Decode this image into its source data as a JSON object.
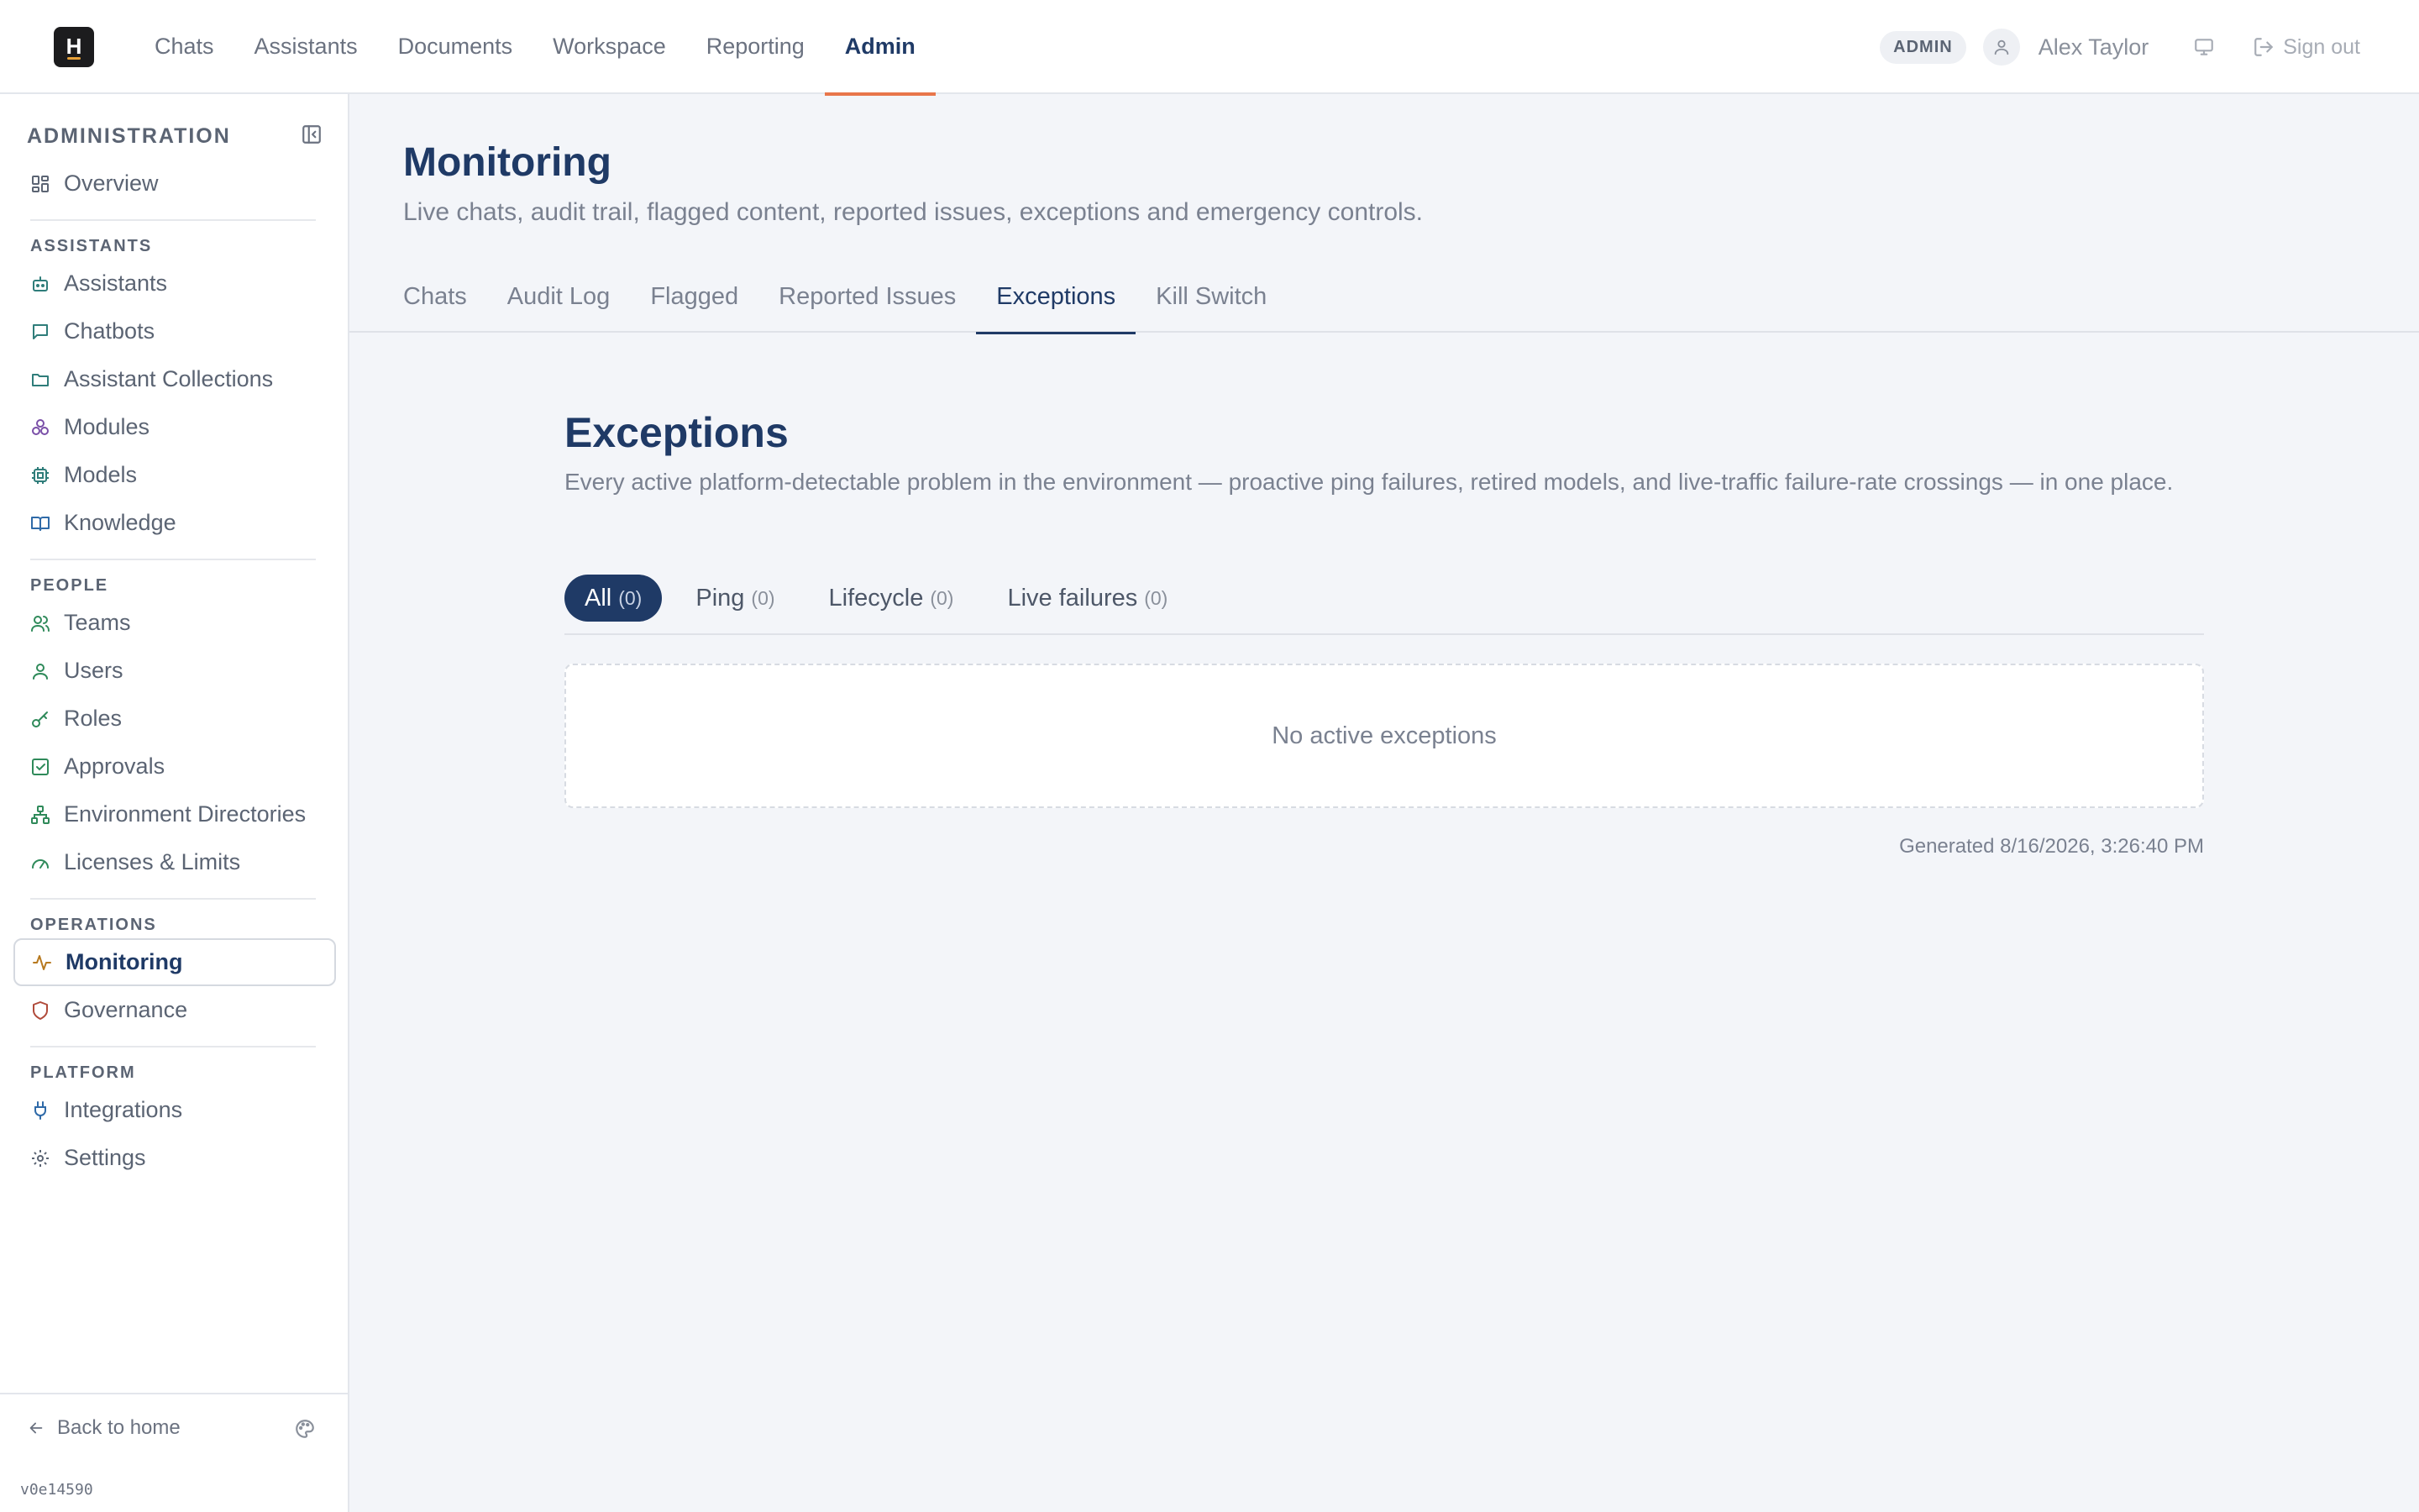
{
  "topnav": {
    "logo_letter": "H",
    "items": [
      {
        "label": "Chats"
      },
      {
        "label": "Assistants"
      },
      {
        "label": "Documents"
      },
      {
        "label": "Workspace"
      },
      {
        "label": "Reporting"
      },
      {
        "label": "Admin",
        "active": true
      }
    ],
    "role_badge": "ADMIN",
    "user_name": "Alex Taylor",
    "sign_out": "Sign out"
  },
  "sidebar": {
    "title": "ADMINISTRATION",
    "overview": "Overview",
    "groups": {
      "assistants": {
        "label": "ASSISTANTS",
        "items": [
          "Assistants",
          "Chatbots",
          "Assistant Collections",
          "Modules",
          "Models",
          "Knowledge"
        ]
      },
      "people": {
        "label": "PEOPLE",
        "items": [
          "Teams",
          "Users",
          "Roles",
          "Approvals",
          "Environment Directories",
          "Licenses & Limits"
        ]
      },
      "operations": {
        "label": "OPERATIONS",
        "items": [
          "Monitoring",
          "Governance"
        ]
      },
      "platform": {
        "label": "PLATFORM",
        "items": [
          "Integrations",
          "Settings"
        ]
      }
    },
    "back_home": "Back to home",
    "version": "v0e14590"
  },
  "main": {
    "title": "Monitoring",
    "subtitle": "Live chats, audit trail, flagged content, reported issues, exceptions and emergency controls.",
    "tabs": [
      "Chats",
      "Audit Log",
      "Flagged",
      "Reported Issues",
      "Exceptions",
      "Kill Switch"
    ],
    "active_tab": "Exceptions",
    "exceptions": {
      "title": "Exceptions",
      "description": "Every active platform-detectable problem in the environment — proactive ping failures, retired models, and live-traffic failure-rate crossings — in one place.",
      "filters": [
        {
          "label": "All",
          "count": "(0)"
        },
        {
          "label": "Ping",
          "count": "(0)"
        },
        {
          "label": "Lifecycle",
          "count": "(0)"
        },
        {
          "label": "Live failures",
          "count": "(0)"
        }
      ],
      "empty_text": "No active exceptions",
      "generated": "Generated 8/16/2026, 3:26:40 PM"
    }
  },
  "colors": {
    "brand_navy": "#1f3a66",
    "accent_orange": "#e8764a",
    "background": "#f3f5f9"
  }
}
